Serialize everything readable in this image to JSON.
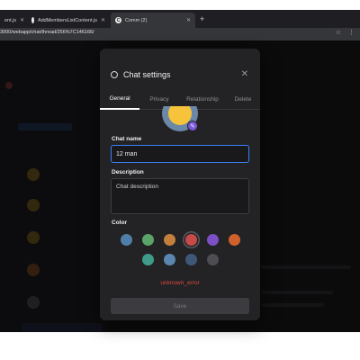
{
  "browser": {
    "tabs": [
      {
        "label": "ent.js"
      },
      {
        "label": "AddMembersListContent.js"
      },
      {
        "label": "Comm (2)",
        "favicon": "C"
      }
    ],
    "url": "3000/webapp/chat/thread/256%7C146166/"
  },
  "modal": {
    "title": "Chat settings",
    "tabs": [
      {
        "label": "General"
      },
      {
        "label": "Privacy"
      },
      {
        "label": "Relationship"
      },
      {
        "label": "Delete"
      }
    ],
    "active_tab": "General",
    "chat_name_label": "Chat name",
    "chat_name_value": "12 man",
    "description_label": "Description",
    "description_placeholder": "Chat description",
    "color_label": "Color",
    "colors": [
      "#4f7fa8",
      "#5aa469",
      "#c47f3d",
      "#c74a4a",
      "#7c4fc4",
      "#d1612c",
      "#3f9c8a",
      "#5a86b0",
      "#3f5878",
      "#4d4d52"
    ],
    "selected_color": "#c74a4a",
    "error_text": "unknown_error",
    "save_label": "Save"
  }
}
